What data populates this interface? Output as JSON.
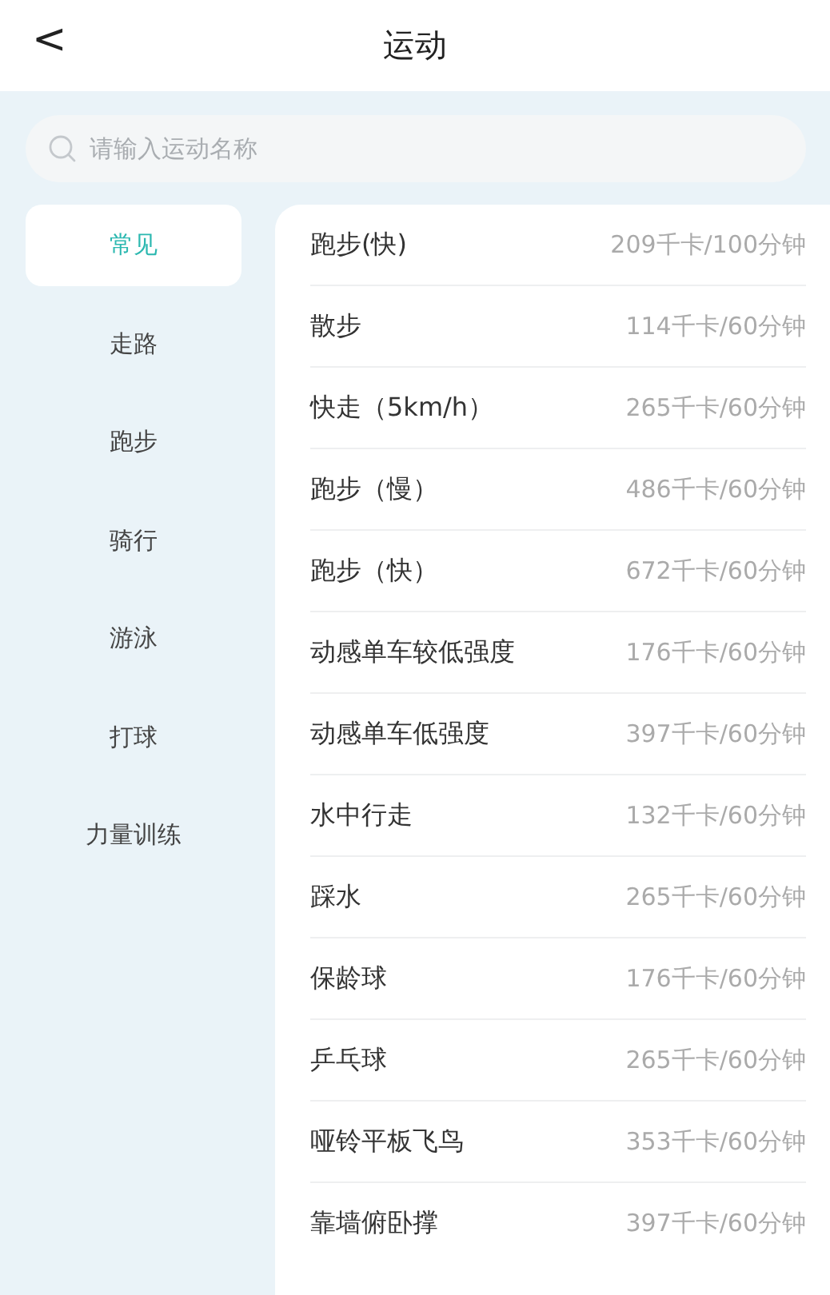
{
  "header": {
    "back": "<",
    "title": "运动"
  },
  "search": {
    "placeholder": "请输入运动名称"
  },
  "categories": [
    {
      "label": "常见",
      "selected": true
    },
    {
      "label": "走路",
      "selected": false
    },
    {
      "label": "跑步",
      "selected": false
    },
    {
      "label": "骑行",
      "selected": false
    },
    {
      "label": "游泳",
      "selected": false
    },
    {
      "label": "打球",
      "selected": false
    },
    {
      "label": "力量训练",
      "selected": false
    }
  ],
  "exercises": [
    {
      "name": "跑步(快)",
      "calories": "209千卡/100分钟"
    },
    {
      "name": "散步",
      "calories": "114千卡/60分钟"
    },
    {
      "name": "快走（5km/h）",
      "calories": "265千卡/60分钟"
    },
    {
      "name": "跑步（慢）",
      "calories": "486千卡/60分钟"
    },
    {
      "name": "跑步（快）",
      "calories": "672千卡/60分钟"
    },
    {
      "name": "动感单车较低强度",
      "calories": "176千卡/60分钟"
    },
    {
      "name": "动感单车低强度",
      "calories": "397千卡/60分钟"
    },
    {
      "name": "水中行走",
      "calories": "132千卡/60分钟"
    },
    {
      "name": "踩水",
      "calories": "265千卡/60分钟"
    },
    {
      "name": "保龄球",
      "calories": "176千卡/60分钟"
    },
    {
      "name": "乒乓球",
      "calories": "265千卡/60分钟"
    },
    {
      "name": "哑铃平板飞鸟",
      "calories": "353千卡/60分钟"
    },
    {
      "name": "靠墙俯卧撑",
      "calories": "397千卡/60分钟"
    }
  ]
}
